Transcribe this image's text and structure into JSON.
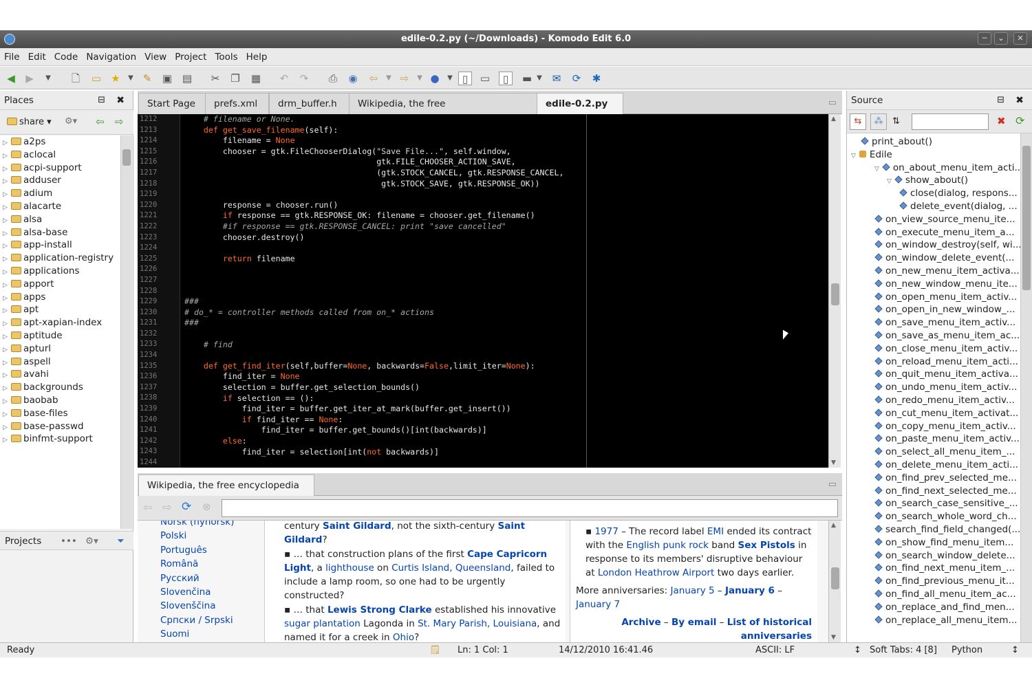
{
  "window": {
    "title": "edile-0.2.py (~/Downloads) - Komodo Edit 6.0"
  },
  "menu": [
    "File",
    "Edit",
    "Code",
    "Navigation",
    "View",
    "Project",
    "Tools",
    "Help"
  ],
  "places": {
    "title": "Places",
    "folder": "share",
    "items": [
      "a2ps",
      "aclocal",
      "acpi-support",
      "adduser",
      "adium",
      "alacarte",
      "alsa",
      "alsa-base",
      "app-install",
      "application-registry",
      "applications",
      "apport",
      "apps",
      "apt",
      "apt-xapian-index",
      "aptitude",
      "apturl",
      "aspell",
      "avahi",
      "backgrounds",
      "baobab",
      "base-files",
      "base-passwd",
      "binfmt-support"
    ],
    "projects_label": "Projects"
  },
  "tabs": [
    "Start Page",
    "prefs.xml",
    "drm_buffer.h",
    "Wikipedia, the free encyclopedia.html",
    "edile-0.2.py"
  ],
  "editor": {
    "line_numbers": [
      "1212",
      "1213",
      "1214",
      "1215",
      "1216",
      "1217",
      "1218",
      "1219",
      "1220",
      "1221",
      "1222",
      "1223",
      "1224",
      "1225",
      "1226",
      "1227",
      "1228",
      "1229",
      "1230",
      "1231",
      "1232",
      "1233",
      "1234",
      "1235",
      "1236",
      "1237",
      "1238",
      "1239",
      "1240",
      "1241",
      "1242",
      "1243",
      "1244"
    ]
  },
  "bottom_tab": "Wikipedia, the free encyclopedia",
  "wiki": {
    "languages": [
      "Norsk (nynorsk)",
      "Polski",
      "Português",
      "Română",
      "Русский",
      "Slovenčina",
      "Slovenščina",
      "Српски / Srpski",
      "Suomi"
    ],
    "col2_more_label": "More anniversaries:",
    "col2_links": [
      "January 5",
      "January 6",
      "January 7"
    ],
    "col2_footer": [
      "Archive",
      "By email",
      "List of historical anniversaries"
    ]
  },
  "source": {
    "title": "Source",
    "items": [
      "print_about()",
      "Edile",
      "on_about_menu_item_acti...",
      "show_about()",
      "close(dialog, respons...",
      "delete_event(dialog, ...",
      "on_view_source_menu_ite...",
      "on_execute_menu_item_a...",
      "on_window_destroy(self, wi...",
      "on_window_delete_event(...",
      "on_new_menu_item_activa...",
      "on_new_window_menu_ite...",
      "on_open_menu_item_activ...",
      "on_open_in_new_window_...",
      "on_save_menu_item_activ...",
      "on_save_as_menu_item_ac...",
      "on_close_menu_item_activ...",
      "on_reload_menu_item_acti...",
      "on_quit_menu_item_activa...",
      "on_undo_menu_item_activ...",
      "on_redo_menu_item_activ...",
      "on_cut_menu_item_activat...",
      "on_copy_menu_item_activ...",
      "on_paste_menu_item_activ...",
      "on_select_all_menu_item_...",
      "on_delete_menu_item_acti...",
      "on_find_prev_selected_me...",
      "on_find_next_selected_me...",
      "on_search_case_sensitive_...",
      "on_search_whole_word_ch...",
      "search_find_field_changed(...",
      "on_show_find_menu_item...",
      "on_search_window_delete...",
      "on_find_next_menu_item_...",
      "on_find_previous_menu_it...",
      "on_find_all_menu_item_ac...",
      "on_replace_and_find_men...",
      "on_replace_all_menu_item..."
    ]
  },
  "status": {
    "ready": "Ready",
    "position": "Ln: 1 Col: 1",
    "datetime": "14/12/2010 16:41.46",
    "encoding": "ASCII: LF",
    "tabs": "Soft Tabs: 4 [8]",
    "language": "Python"
  },
  "colors": {
    "keyword": "#ff6a2a",
    "comment": "#a7a7a7",
    "link": "#0645ad",
    "editor_bg": "#000000"
  }
}
